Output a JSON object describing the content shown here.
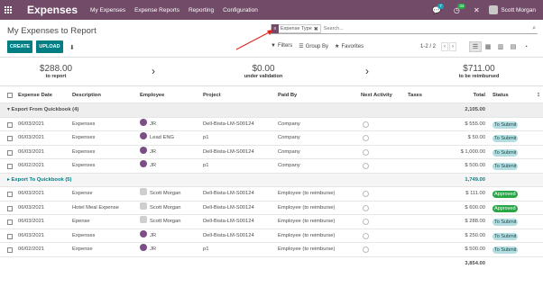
{
  "navbar": {
    "brand": "Expenses",
    "menu": [
      "My Expenses",
      "Expense Reports",
      "Reporting",
      "Configuration"
    ],
    "chat_count": "7",
    "activity_count": "34",
    "user_name": "Scott Morgan"
  },
  "control_panel": {
    "breadcrumb": "My Expenses to Report",
    "create_label": "CREATE",
    "upload_label": "UPLOAD",
    "search": {
      "facet_label": "Expense Type",
      "placeholder": "Search..."
    },
    "filters_label": "Filters",
    "group_by_label": "Group By",
    "favorites_label": "Favorites",
    "pager": "1-2 / 2"
  },
  "summary": [
    {
      "amount": "$288.00",
      "label": "to report"
    },
    {
      "amount": "$0.00",
      "label": "under validation"
    },
    {
      "amount": "$711.00",
      "label": "to be reimbursed"
    }
  ],
  "table": {
    "headers": {
      "date": "Expense Date",
      "description": "Description",
      "employee": "Employee",
      "project": "Project",
      "paid_by": "Paid By",
      "next_activity": "Next Activity",
      "taxes": "Taxes",
      "total": "Total",
      "status": "Status"
    },
    "groups": [
      {
        "label": "Export From Quickbook (4)",
        "total": "2,105.00",
        "rows": [
          {
            "date": "06/03/2021",
            "description": "Expenses",
            "employee": "JR",
            "project": "Dell-Bista-LM-S00124",
            "paid_by": "Company",
            "total": "$ 555.00",
            "status": "To Submit"
          },
          {
            "date": "06/03/2021",
            "description": "Expenses",
            "employee": "Lead ENG",
            "project": "p1",
            "paid_by": "Company",
            "total": "$ 50.00",
            "status": "To Submit"
          },
          {
            "date": "06/03/2021",
            "description": "Expenses",
            "employee": "JR",
            "project": "Dell-Bista-LM-S00124",
            "paid_by": "Company",
            "total": "$ 1,000.00",
            "status": "To Submit"
          },
          {
            "date": "06/02/2021",
            "description": "Expenses",
            "employee": "JR",
            "project": "p1",
            "paid_by": "Company",
            "total": "$ 500.00",
            "status": "To Submit"
          }
        ]
      },
      {
        "label": "Export To Quickbook (5)",
        "total": "1,749.00",
        "rows": [
          {
            "date": "06/03/2021",
            "description": "Expense",
            "employee": "Scott Morgan",
            "project": "Dell-Bista-LM-S00124",
            "paid_by": "Employee (to reimburse)",
            "total": "$ 111.00",
            "status": "Approved"
          },
          {
            "date": "06/03/2021",
            "description": "Hotel Meal Expense",
            "employee": "Scott Morgan",
            "project": "Dell-Bista-LM-S00124",
            "paid_by": "Employee (to reimburse)",
            "total": "$ 600.00",
            "status": "Approved"
          },
          {
            "date": "06/03/2021",
            "description": "Epense",
            "employee": "Scott Morgan",
            "project": "Dell-Bista-LM-S00124",
            "paid_by": "Employee (to reimburse)",
            "total": "$ 288.00",
            "status": "To Submit"
          },
          {
            "date": "06/03/2021",
            "description": "Expenses",
            "employee": "JR",
            "project": "Dell-Bista-LM-S00124",
            "paid_by": "Employee (to reimburse)",
            "total": "$ 250.00",
            "status": "To Submit"
          },
          {
            "date": "06/02/2021",
            "description": "Expense",
            "employee": "JR",
            "project": "p1",
            "paid_by": "Employee (to reimburse)",
            "total": "$ 500.00",
            "status": "To Submit"
          }
        ]
      }
    ],
    "grand_total": "3,854.00"
  },
  "colors": {
    "navbar": "#714b67",
    "primary_button": "#017e84",
    "status_to_submit": "#b3dde0",
    "status_approved": "#28a745",
    "annotation_arrow": "#e0201b"
  },
  "icons": [
    "app-grid-icon",
    "chat-icon",
    "activity-icon",
    "close-icon",
    "download-icon",
    "search-icon",
    "filter-icon",
    "group-by-icon",
    "favorites-icon",
    "list-view-icon",
    "kanban-view-icon",
    "graph-view-icon",
    "pivot-view-icon",
    "activity-view-icon",
    "chevron-right-icon",
    "optional-columns-icon"
  ]
}
